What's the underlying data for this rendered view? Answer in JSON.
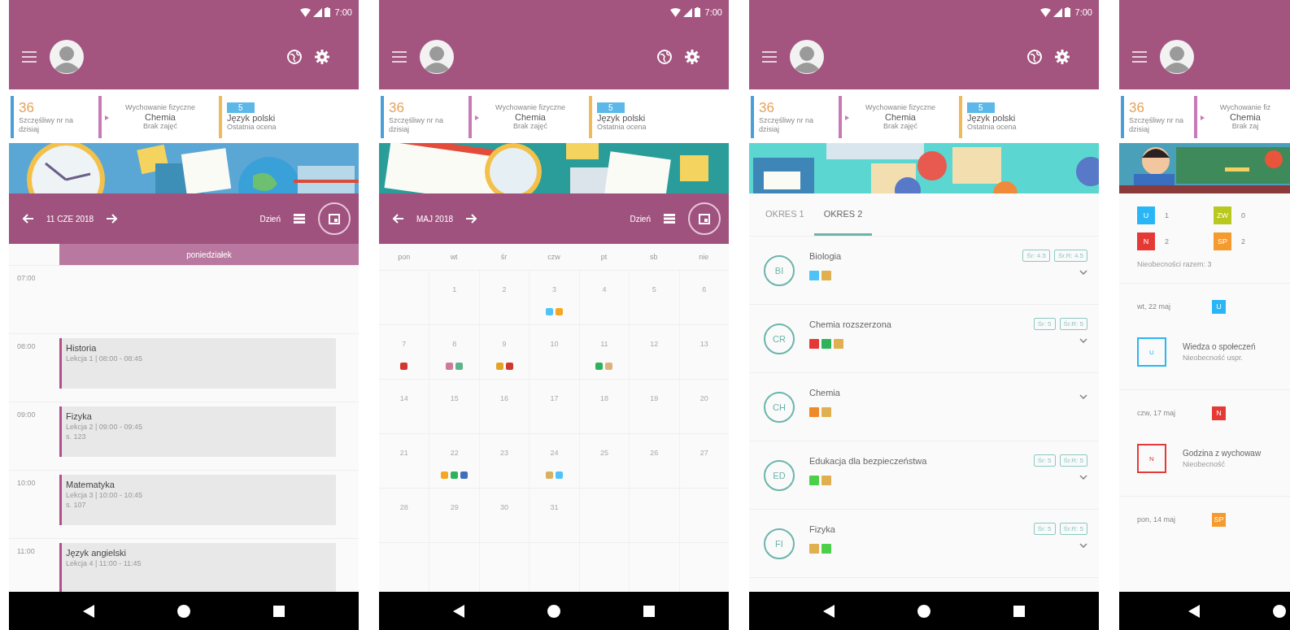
{
  "screens": [
    {
      "kind": "timetable",
      "status_bar": {
        "time": "7:00"
      },
      "summary": {
        "lucky_number": "36",
        "lucky_label": "Szczęśliwy nr na dzisiaj",
        "next_caption": "Wychowanie fizyczne",
        "next_subject": "Chemia",
        "next_note": "Brak zajęć",
        "grade": "5",
        "grade_subject": "Język polski",
        "grade_label": "Ostatnia ocena"
      },
      "period_bar": {
        "label": "11 CZE 2018",
        "view": "Dzień"
      },
      "timetable": {
        "day": "poniedziałek",
        "slots": [
          {
            "time": "07:00"
          },
          {
            "time": "08:00",
            "lesson": {
              "title": "Historia",
              "detail": "Lekcja 1 | 08:00 - 08:45"
            }
          },
          {
            "time": "09:00",
            "lesson": {
              "title": "Fizyka",
              "detail": "Lekcja 2 | 09:00 - 09:45",
              "room": "s. 123"
            }
          },
          {
            "time": "10:00",
            "lesson": {
              "title": "Matematyka",
              "detail": "Lekcja 3 | 10:00 - 10:45",
              "room": "s. 107"
            }
          },
          {
            "time": "11:00",
            "lesson": {
              "title": "Język angielski",
              "detail": "Lekcja 4 | 11:00 - 11:45"
            }
          }
        ]
      }
    },
    {
      "kind": "calendar",
      "status_bar": {
        "time": "7:00"
      },
      "summary": {
        "lucky_number": "36",
        "lucky_label": "Szczęśliwy nr na dzisiaj",
        "next_caption": "Wychowanie fizyczne",
        "next_subject": "Chemia",
        "next_note": "Brak zajęć",
        "grade": "5",
        "grade_subject": "Język polski",
        "grade_label": "Ostatnia ocena"
      },
      "period_bar": {
        "label": "MAJ 2018",
        "view": "Dzień"
      },
      "calendar": {
        "weekdays": [
          "pon",
          "wt",
          "śr",
          "czw",
          "pt",
          "sb",
          "nie"
        ],
        "weeks": [
          {
            "days": [
              {
                "kind": "blank"
              },
              {
                "kind": "day",
                "date": "1"
              },
              {
                "kind": "day",
                "date": "2"
              },
              {
                "kind": "day",
                "date": "3",
                "dots": [
                  {
                    "color": "#4fc3f7"
                  },
                  {
                    "color": "#f5a623"
                  }
                ]
              },
              {
                "kind": "day",
                "date": "4"
              },
              {
                "kind": "day",
                "date": "5"
              },
              {
                "kind": "day",
                "date": "6"
              }
            ]
          },
          {
            "days": [
              {
                "kind": "day",
                "date": "7",
                "dots": [
                  {
                    "color": "#d0382e"
                  }
                ]
              },
              {
                "kind": "day",
                "date": "8",
                "dots": [
                  {
                    "color": "#d07a9a"
                  },
                  {
                    "color": "#5fb38a"
                  }
                ]
              },
              {
                "kind": "day",
                "date": "9",
                "dots": [
                  {
                    "color": "#e0a526"
                  },
                  {
                    "color": "#d0382e"
                  }
                ]
              },
              {
                "kind": "day",
                "date": "10"
              },
              {
                "kind": "day",
                "date": "11",
                "dots": [
                  {
                    "color": "#2fb35a"
                  },
                  {
                    "color": "#e0b07a"
                  }
                ]
              },
              {
                "kind": "day",
                "date": "12"
              },
              {
                "kind": "day",
                "date": "13"
              }
            ]
          },
          {
            "days": [
              {
                "kind": "day",
                "date": "14"
              },
              {
                "kind": "day",
                "date": "15"
              },
              {
                "kind": "day",
                "date": "16"
              },
              {
                "kind": "day",
                "date": "17"
              },
              {
                "kind": "day",
                "date": "18"
              },
              {
                "kind": "day",
                "date": "19"
              },
              {
                "kind": "day",
                "date": "20"
              }
            ]
          },
          {
            "days": [
              {
                "kind": "day",
                "date": "21"
              },
              {
                "kind": "day",
                "date": "22",
                "dots": [
                  {
                    "color": "#f5a623"
                  },
                  {
                    "color": "#2fb35a"
                  },
                  {
                    "color": "#3f6fb8"
                  }
                ]
              },
              {
                "kind": "day",
                "date": "23"
              },
              {
                "kind": "day",
                "date": "24",
                "dots": [
                  {
                    "color": "#d8b060"
                  },
                  {
                    "color": "#4fc3f7"
                  }
                ]
              },
              {
                "kind": "day",
                "date": "25"
              },
              {
                "kind": "day",
                "date": "26"
              },
              {
                "kind": "day",
                "date": "27"
              }
            ]
          },
          {
            "days": [
              {
                "kind": "day",
                "date": "28"
              },
              {
                "kind": "day",
                "date": "29"
              },
              {
                "kind": "day",
                "date": "30"
              },
              {
                "kind": "day",
                "date": "31"
              },
              {
                "kind": "blank"
              },
              {
                "kind": "blank"
              },
              {
                "kind": "blank"
              }
            ]
          },
          {
            "days": [
              {
                "kind": "blank"
              },
              {
                "kind": "blank"
              },
              {
                "kind": "blank"
              },
              {
                "kind": "blank"
              },
              {
                "kind": "blank"
              },
              {
                "kind": "blank"
              },
              {
                "kind": "blank"
              }
            ]
          }
        ]
      }
    },
    {
      "kind": "grades",
      "status_bar": {
        "time": "7:00"
      },
      "summary": {
        "lucky_number": "36",
        "lucky_label": "Szczęśliwy nr na dzisiaj",
        "next_caption": "Wychowanie fizyczne",
        "next_subject": "Chemia",
        "next_note": "Brak zajęć",
        "grade": "5",
        "grade_subject": "Język polski",
        "grade_label": "Ostatnia ocena"
      },
      "tabs": [
        {
          "label": "OKRES 1",
          "selected": false
        },
        {
          "label": "OKRES 2",
          "selected": true
        }
      ],
      "subjects": [
        {
          "initials": "BI",
          "name": "Biologia",
          "grades": [
            {
              "color": "#4fc3f7"
            },
            {
              "color": "#e0b050"
            }
          ],
          "averages": [
            "Śr: 4.5",
            "Śr.R: 4.5"
          ]
        },
        {
          "initials": "CR",
          "name": "Chemia rozszerzona",
          "grades": [
            {
              "color": "#e53935"
            },
            {
              "color": "#2fb35a"
            },
            {
              "color": "#e0b050"
            }
          ],
          "averages": [
            "Śr: 5",
            "Śr.R: 5"
          ]
        },
        {
          "initials": "CH",
          "name": "Chemia",
          "grades": [
            {
              "color": "#ef8a2a"
            },
            {
              "color": "#e0b050"
            }
          ]
        },
        {
          "initials": "ED",
          "name": "Edukacja dla bezpieczeństwa",
          "grades": [
            {
              "color": "#4cd04a"
            },
            {
              "color": "#e0b050"
            }
          ],
          "averages": [
            "Śr: 5",
            "Śr.R: 5"
          ]
        },
        {
          "initials": "FI",
          "name": "Fizyka",
          "grades": [
            {
              "color": "#e0b050"
            },
            {
              "color": "#4cd04a"
            }
          ],
          "averages": [
            "Śr: 5",
            "Śr.R: 5"
          ]
        }
      ]
    },
    {
      "kind": "absences",
      "summary": {
        "lucky_number": "36",
        "lucky_label": "Szczęśliwy nr na dzisiaj",
        "next_caption": "Wychowanie fiz",
        "next_subject": "Chemia",
        "next_note": "Brak zaj"
      },
      "legend": [
        {
          "code": "U",
          "count": "1",
          "color": "#29b6f6"
        },
        {
          "code": "ZW",
          "count": "0",
          "color": "#b8c81e"
        },
        {
          "code": "N",
          "count": "2",
          "color": "#e53935"
        },
        {
          "code": "SP",
          "count": "2",
          "color": "#f59a2e"
        }
      ],
      "total": "Nieobecności razem: 3",
      "days": [
        {
          "date": "wt, 22 maj",
          "badge": {
            "code": "U",
            "color": "#29b6f6"
          },
          "entries": [
            {
              "code": "U",
              "color": "#29b6f6",
              "subject": "Wiedza o społeczeń",
              "note": "Nieobecność uspr."
            }
          ]
        },
        {
          "date": "czw, 17 maj",
          "badge": {
            "code": "N",
            "color": "#e53935"
          },
          "entries": [
            {
              "code": "N",
              "color": "#e53935",
              "subject": "Godzina z wychowaw",
              "note": "Nieobecność"
            }
          ]
        },
        {
          "date": "pon, 14 maj",
          "badge": {
            "code": "SP",
            "color": "#f59a2e"
          }
        }
      ]
    }
  ]
}
